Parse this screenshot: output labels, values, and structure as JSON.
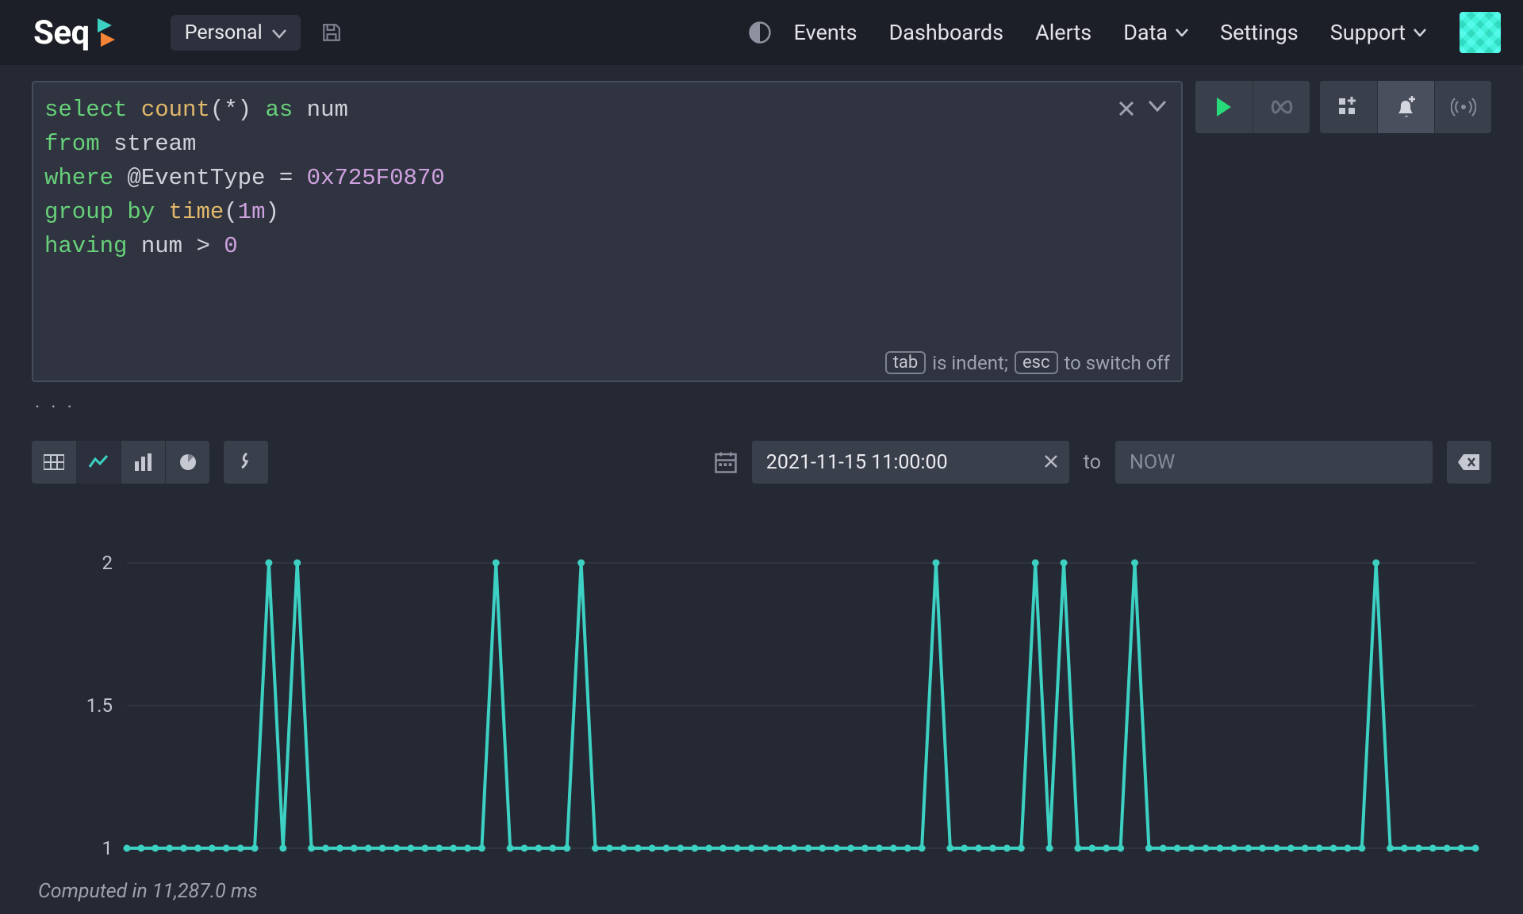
{
  "header": {
    "logo_text": "Seq",
    "workspace_label": "Personal",
    "nav": {
      "events": "Events",
      "dashboards": "Dashboards",
      "alerts": "Alerts",
      "data": "Data",
      "settings": "Settings",
      "support": "Support"
    }
  },
  "query": {
    "tokens": [
      [
        {
          "t": "select",
          "c": "kw"
        },
        {
          "t": " ",
          "c": "op"
        },
        {
          "t": "count",
          "c": "fn"
        },
        {
          "t": "(*) ",
          "c": "op"
        },
        {
          "t": "as",
          "c": "kw"
        },
        {
          "t": " num",
          "c": "id"
        }
      ],
      [
        {
          "t": "from",
          "c": "kw"
        },
        {
          "t": " stream",
          "c": "id"
        }
      ],
      [
        {
          "t": "where",
          "c": "kw"
        },
        {
          "t": " @EventType ",
          "c": "id"
        },
        {
          "t": "=",
          "c": "op"
        },
        {
          "t": " ",
          "c": "op"
        },
        {
          "t": "0x725F0870",
          "c": "lit"
        }
      ],
      [
        {
          "t": "group by",
          "c": "kw"
        },
        {
          "t": " ",
          "c": "op"
        },
        {
          "t": "time",
          "c": "fn"
        },
        {
          "t": "(",
          "c": "op"
        },
        {
          "t": "1m",
          "c": "lit"
        },
        {
          "t": ")",
          "c": "op"
        }
      ],
      [
        {
          "t": "having",
          "c": "kw"
        },
        {
          "t": " num ",
          "c": "id"
        },
        {
          "t": ">",
          "c": "op"
        },
        {
          "t": " ",
          "c": "op"
        },
        {
          "t": "0",
          "c": "lit"
        }
      ]
    ],
    "hint_tab": "tab",
    "hint_mid": " is indent; ",
    "hint_esc": "esc",
    "hint_end": " to switch off"
  },
  "ellipsis": ". . .",
  "time_range": {
    "from": "2021-11-15 11:00:00",
    "to_label": "to",
    "to": "NOW"
  },
  "status_text": "Computed in 11,287.0 ms",
  "chart_data": {
    "type": "line",
    "ylabel": "",
    "xlabel": "",
    "ylim": [
      1,
      2
    ],
    "yticks": [
      1,
      1.5,
      2
    ],
    "values": [
      1,
      1,
      1,
      1,
      1,
      1,
      1,
      1,
      1,
      1,
      2,
      1,
      2,
      1,
      1,
      1,
      1,
      1,
      1,
      1,
      1,
      1,
      1,
      1,
      1,
      1,
      2,
      1,
      1,
      1,
      1,
      1,
      2,
      1,
      1,
      1,
      1,
      1,
      1,
      1,
      1,
      1,
      1,
      1,
      1,
      1,
      1,
      1,
      1,
      1,
      1,
      1,
      1,
      1,
      1,
      1,
      1,
      2,
      1,
      1,
      1,
      1,
      1,
      1,
      2,
      1,
      2,
      1,
      1,
      1,
      1,
      2,
      1,
      1,
      1,
      1,
      1,
      1,
      1,
      1,
      1,
      1,
      1,
      1,
      1,
      1,
      1,
      1,
      2,
      1,
      1,
      1,
      1,
      1,
      1,
      1
    ],
    "series_color": "#3cd1c2"
  }
}
